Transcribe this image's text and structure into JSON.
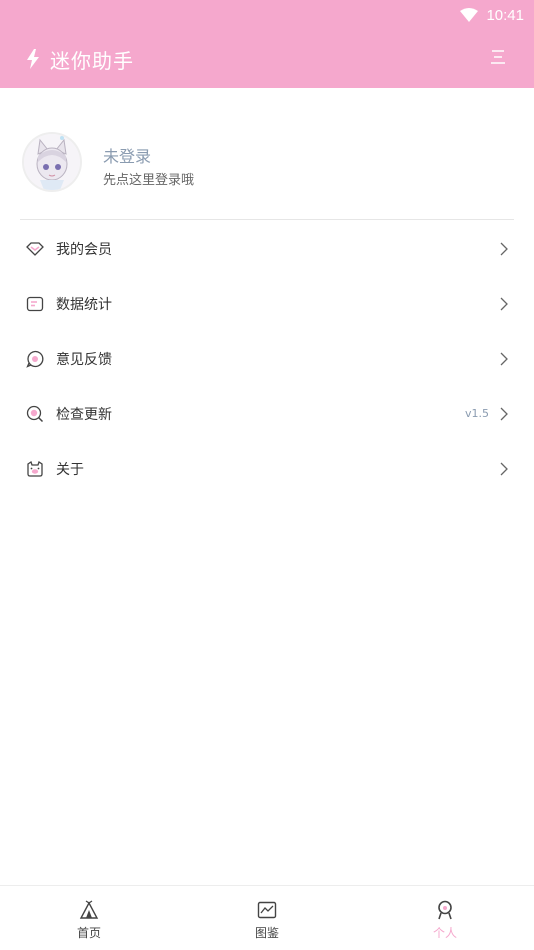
{
  "status_bar": {
    "time": "10:41"
  },
  "app_bar": {
    "title": "迷你助手"
  },
  "profile": {
    "login_title": "未登录",
    "login_subtitle": "先点这里登录哦"
  },
  "menu": {
    "items": [
      {
        "label": "我的会员",
        "icon": "diamond-icon"
      },
      {
        "label": "数据统计",
        "icon": "card-icon"
      },
      {
        "label": "意见反馈",
        "icon": "chat-bubble-icon"
      },
      {
        "label": "检查更新",
        "icon": "search-icon",
        "version": "v1.5"
      },
      {
        "label": "关于",
        "icon": "pig-face-icon"
      }
    ]
  },
  "tabbar": {
    "tabs": [
      {
        "label": "首页",
        "icon": "tent-icon"
      },
      {
        "label": "图鉴",
        "icon": "image-chart-icon"
      },
      {
        "label": "个人",
        "icon": "person-icon",
        "active": true
      }
    ]
  },
  "colors": {
    "accent": "#f5a8cd",
    "muted": "#8a9bb0"
  }
}
